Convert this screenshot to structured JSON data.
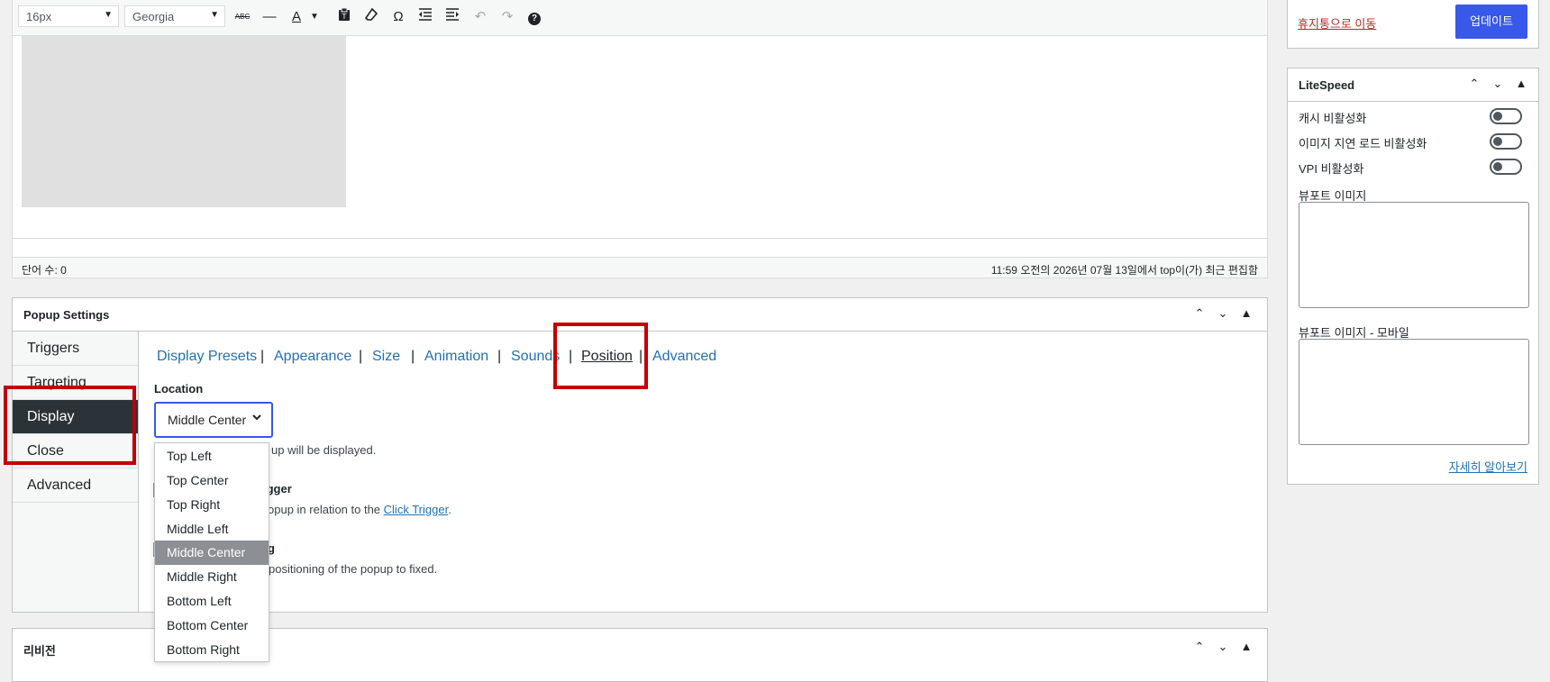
{
  "toolbar": {
    "font_size": "16px",
    "font_family": "Georgia",
    "icons": [
      "strikethrough-icon",
      "horizontal-line-icon",
      "text-color-icon",
      "paste-text-icon",
      "clear-formatting-icon",
      "special-character-icon",
      "outdent-icon",
      "indent-icon",
      "undo-icon",
      "redo-icon",
      "help-icon"
    ],
    "strike_label": "ABC",
    "color_label": "A",
    "omega_label": "Ω",
    "help_label": "?"
  },
  "status": {
    "word_count": "단어 수: 0",
    "last_edited": "11:59 오전의 2026년 07월 13일에서 top이(가) 최근 편집함"
  },
  "popup_settings": {
    "title": "Popup Settings",
    "vtabs": [
      "Triggers",
      "Targeting",
      "Display",
      "Close",
      "Advanced"
    ],
    "active_vtab": "Display",
    "htabs": [
      "Display Presets",
      "Appearance",
      "Size",
      "Animation",
      "Sounds",
      "Position",
      "Advanced"
    ],
    "active_htab": "Position",
    "location_label": "Location",
    "location_value": "Middle Center",
    "location_help": "up will be displayed.",
    "trigger_label": "igger",
    "trigger_help_prefix": "opup in relation to the ",
    "trigger_help_link": "Click Trigger",
    "trigger_help_suffix": ".",
    "fixed_label": "g",
    "fixed_help": "positioning of the popup to fixed.",
    "options": [
      "Top Left",
      "Top Center",
      "Top Right",
      "Middle Left",
      "Middle Center",
      "Middle Right",
      "Bottom Left",
      "Bottom Center",
      "Bottom Right"
    ],
    "selected_option": "Middle Center"
  },
  "revisions": {
    "title": "리비전"
  },
  "publish": {
    "trash": "휴지통으로 이동",
    "update": "업데이트"
  },
  "litespeed": {
    "title": "LiteSpeed",
    "toggles": [
      "캐시 비활성화",
      "이미지 지연 로드 비활성화",
      "VPI 비활성화"
    ],
    "viewport_image": "뷰포트 이미지",
    "viewport_image_mobile": "뷰포트 이미지 - 모바일",
    "learn_more": "자세히 알아보기"
  },
  "colors": {
    "accent": "#3858e9",
    "link": "#2271b1",
    "annotation": "#c00000",
    "active_tab": "#2c3338"
  }
}
